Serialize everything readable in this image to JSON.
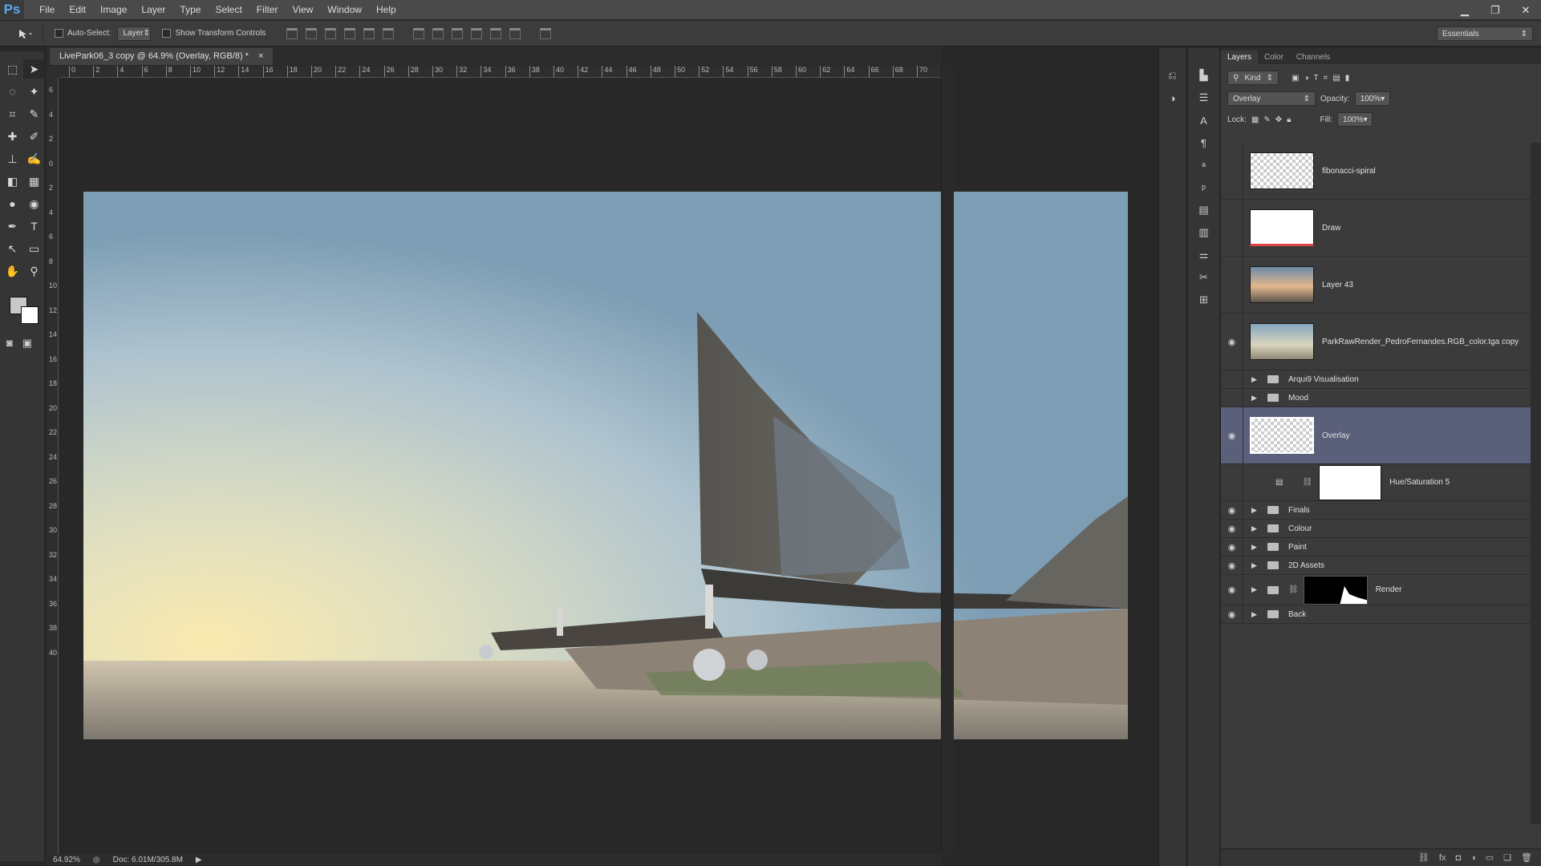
{
  "app": {
    "logo": "Ps"
  },
  "menu": [
    "File",
    "Edit",
    "Image",
    "Layer",
    "Type",
    "Select",
    "Filter",
    "View",
    "Window",
    "Help"
  ],
  "options": {
    "auto_select_label": "Auto-Select:",
    "auto_select_value": "Layer",
    "show_transform_label": "Show Transform Controls",
    "workspace": "Essentials"
  },
  "document": {
    "tab_title": "LivePark06_3 copy @ 64.9% (Overlay, RGB/8) *",
    "close": "×",
    "zoom": "64.92%",
    "doc_info": "Doc: 6.01M/305.8M",
    "ruler_h": [
      "0",
      "2",
      "4",
      "6",
      "8",
      "10",
      "12",
      "14",
      "16",
      "18",
      "20",
      "22",
      "24",
      "26",
      "28",
      "30",
      "32",
      "34",
      "36",
      "38",
      "40",
      "42",
      "44",
      "46",
      "48",
      "50",
      "52",
      "54",
      "56",
      "58",
      "60",
      "62",
      "64",
      "66",
      "68",
      "70"
    ],
    "ruler_v": [
      "6",
      "4",
      "2",
      "0",
      "2",
      "4",
      "6",
      "8",
      "10",
      "12",
      "14",
      "16",
      "18",
      "20",
      "22",
      "24",
      "26",
      "28",
      "30",
      "32",
      "34",
      "36",
      "38",
      "40"
    ]
  },
  "layers_panel": {
    "tabs": [
      "Layers",
      "Color",
      "Channels"
    ],
    "filter": "Kind",
    "blend_mode": "Overlay",
    "opacity_label": "Opacity:",
    "opacity": "100%",
    "lock_label": "Lock:",
    "fill_label": "Fill:",
    "fill": "100%",
    "layers": [
      {
        "name": "fibonacci-spiral",
        "visible": false,
        "type": "layer",
        "thumb": "checker"
      },
      {
        "name": "Draw",
        "visible": false,
        "type": "layer",
        "thumb": "draw"
      },
      {
        "name": "Layer 43",
        "visible": false,
        "type": "layer",
        "thumb": "photo"
      },
      {
        "name": "ParkRawRender_PedroFernandes.RGB_color.tga copy",
        "visible": true,
        "type": "layer",
        "thumb": "photo2"
      },
      {
        "name": "Arqui9 Visualisation",
        "visible": false,
        "type": "group"
      },
      {
        "name": "Mood",
        "visible": false,
        "type": "group"
      },
      {
        "name": "Overlay",
        "visible": true,
        "type": "layer",
        "thumb": "checker",
        "selected": true
      },
      {
        "name": "Hue/Saturation 5",
        "visible": false,
        "type": "adjustment"
      },
      {
        "name": "Finals",
        "visible": true,
        "type": "group"
      },
      {
        "name": "Colour",
        "visible": true,
        "type": "group"
      },
      {
        "name": "Paint",
        "visible": true,
        "type": "group"
      },
      {
        "name": "2D Assets",
        "visible": true,
        "type": "group"
      },
      {
        "name": "Render",
        "visible": true,
        "type": "group-mask"
      },
      {
        "name": "Back",
        "visible": true,
        "type": "group"
      }
    ]
  },
  "icons": {
    "tools": [
      "marquee-icon",
      "move-icon",
      "lasso-icon",
      "magic-wand-icon",
      "crop-icon",
      "eyedropper-icon",
      "healing-icon",
      "brush-icon",
      "stamp-icon",
      "history-brush-icon",
      "eraser-icon",
      "gradient-icon",
      "blur-icon",
      "dodge-icon",
      "pen-icon",
      "type-icon",
      "path-select-icon",
      "rectangle-icon",
      "hand-icon",
      "zoom-icon"
    ],
    "tool_glyphs": [
      "⬚",
      "➤",
      "◌",
      "✦",
      "⌗",
      "✎",
      "✚",
      "✐",
      "⊥",
      "✍",
      "◧",
      "▦",
      "●",
      "◉",
      "✒",
      "T",
      "↖",
      "▭",
      "✋",
      "⚲"
    ]
  },
  "colors": {
    "selected_layer": "#5a6079",
    "accent": "#5aa9f0"
  }
}
